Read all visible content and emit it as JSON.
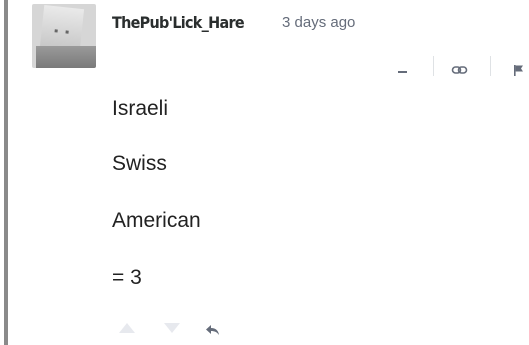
{
  "comment": {
    "author": "ThePub'Lick_Hare",
    "timestamp": "3 days ago",
    "lines": [
      "Israeli",
      "Swiss",
      "American",
      "= 3"
    ]
  },
  "icons": {
    "collapse": "minus-icon",
    "link": "link-icon",
    "flag": "flag-icon",
    "upvote": "triangle-up-icon",
    "downvote": "triangle-down-icon",
    "reply": "reply-arrow-icon"
  },
  "colors": {
    "thread_bar": "#8a8a8a",
    "meta_text": "#656c7a",
    "body_text": "#222222"
  }
}
